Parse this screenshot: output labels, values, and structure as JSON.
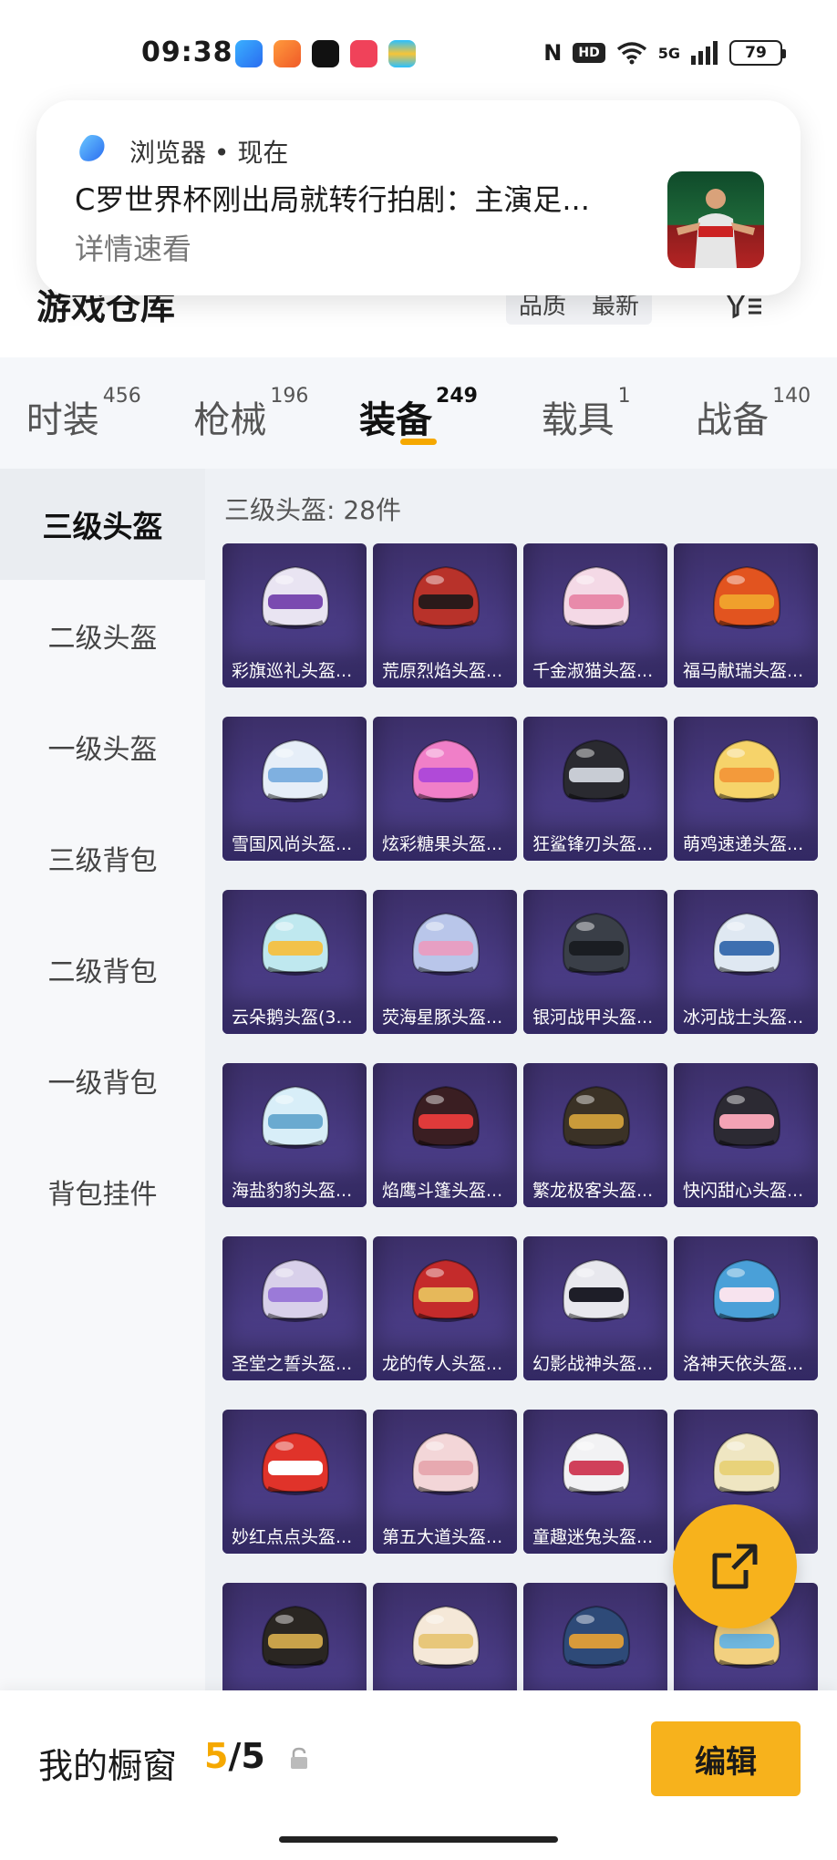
{
  "status_bar": {
    "time": "09:38",
    "battery": "79",
    "network": "5G",
    "hd": "HD",
    "nfc": "N"
  },
  "notification": {
    "source": "浏览器 • 现在",
    "title": "C罗世界杯刚出局就转行拍剧：主演足...",
    "subtitle": "详情速看"
  },
  "header": {
    "title": "游戏仓库",
    "sort_quality": "品质",
    "sort_latest": "最新"
  },
  "tabs": [
    {
      "label": "时装",
      "count": "456",
      "active": false
    },
    {
      "label": "枪械",
      "count": "196",
      "active": false
    },
    {
      "label": "装备",
      "count": "249",
      "active": true
    },
    {
      "label": "载具",
      "count": "1",
      "active": false
    },
    {
      "label": "战备",
      "count": "140",
      "active": false
    }
  ],
  "sidebar": {
    "items": [
      {
        "label": "三级头盔",
        "active": true
      },
      {
        "label": "二级头盔",
        "active": false
      },
      {
        "label": "一级头盔",
        "active": false
      },
      {
        "label": "三级背包",
        "active": false
      },
      {
        "label": "二级背包",
        "active": false
      },
      {
        "label": "一级背包",
        "active": false
      },
      {
        "label": "背包挂件",
        "active": false
      }
    ]
  },
  "grid": {
    "title": "三级头盔: 28件",
    "items": [
      {
        "name": "彩旗巡礼头盔...",
        "color": "#e9e4f2",
        "accent": "#7a4bb0"
      },
      {
        "name": "荒原烈焰头盔...",
        "color": "#b8322a",
        "accent": "#2b1a1a"
      },
      {
        "name": "千金淑猫头盔...",
        "color": "#f4d9e6",
        "accent": "#e88aaa"
      },
      {
        "name": "福马献瑞头盔...",
        "color": "#e2541f",
        "accent": "#f0a02c"
      },
      {
        "name": "雪国风尚头盔...",
        "color": "#e6eef8",
        "accent": "#7fb0e0"
      },
      {
        "name": "炫彩糖果头盔...",
        "color": "#f07fc8",
        "accent": "#b04ad8"
      },
      {
        "name": "狂鲨锋刃头盔...",
        "color": "#2a2a30",
        "accent": "#c8ccd4"
      },
      {
        "name": "萌鸡速递头盔...",
        "color": "#f6d36a",
        "accent": "#f39a3b"
      },
      {
        "name": "云朵鹅头盔(3...",
        "color": "#bfe8ef",
        "accent": "#f2c24a"
      },
      {
        "name": "荧海星豚头盔...",
        "color": "#b9c6ea",
        "accent": "#e79fc3"
      },
      {
        "name": "银河战甲头盔...",
        "color": "#3a3f48",
        "accent": "#1a1d22"
      },
      {
        "name": "冰河战士头盔...",
        "color": "#dfe8f2",
        "accent": "#3d6fb0"
      },
      {
        "name": "海盐豹豹头盔...",
        "color": "#d8eef8",
        "accent": "#6aaad0"
      },
      {
        "name": "焰鹰斗篷头盔...",
        "color": "#3a1e22",
        "accent": "#e03a3a"
      },
      {
        "name": "繁龙极客头盔...",
        "color": "#3b3226",
        "accent": "#c99a3a"
      },
      {
        "name": "快闪甜心头盔...",
        "color": "#2c2a33",
        "accent": "#f3a3b5"
      },
      {
        "name": "圣堂之誓头盔...",
        "color": "#d8d0ea",
        "accent": "#9b7ad8"
      },
      {
        "name": "龙的传人头盔...",
        "color": "#c42b2b",
        "accent": "#e6b85a"
      },
      {
        "name": "幻影战神头盔...",
        "color": "#e8e8ee",
        "accent": "#1e1e28"
      },
      {
        "name": "洛神天依头盔...",
        "color": "#4aa0d8",
        "accent": "#f7e3ee"
      },
      {
        "name": "妙红点点头盔...",
        "color": "#e0332a",
        "accent": "#ffffff"
      },
      {
        "name": "第五大道头盔...",
        "color": "#f3d6d8",
        "accent": "#e7a9b0"
      },
      {
        "name": "童趣迷兔头盔...",
        "color": "#f2f2f4",
        "accent": "#d0405a"
      },
      {
        "name": "",
        "color": "#efe6c2",
        "accent": "#e8d27a"
      },
      {
        "name": "",
        "color": "#2a2622",
        "accent": "#c9a24a"
      },
      {
        "name": "",
        "color": "#f5e8d8",
        "accent": "#e8c77a"
      },
      {
        "name": "",
        "color": "#2e4a78",
        "accent": "#d89a3a"
      },
      {
        "name": "",
        "color": "#f2d080",
        "accent": "#70b8e0"
      }
    ]
  },
  "bottom_bar": {
    "label": "我的橱窗",
    "count_current": "5",
    "count_total": "/5",
    "edit_label": "编辑"
  }
}
